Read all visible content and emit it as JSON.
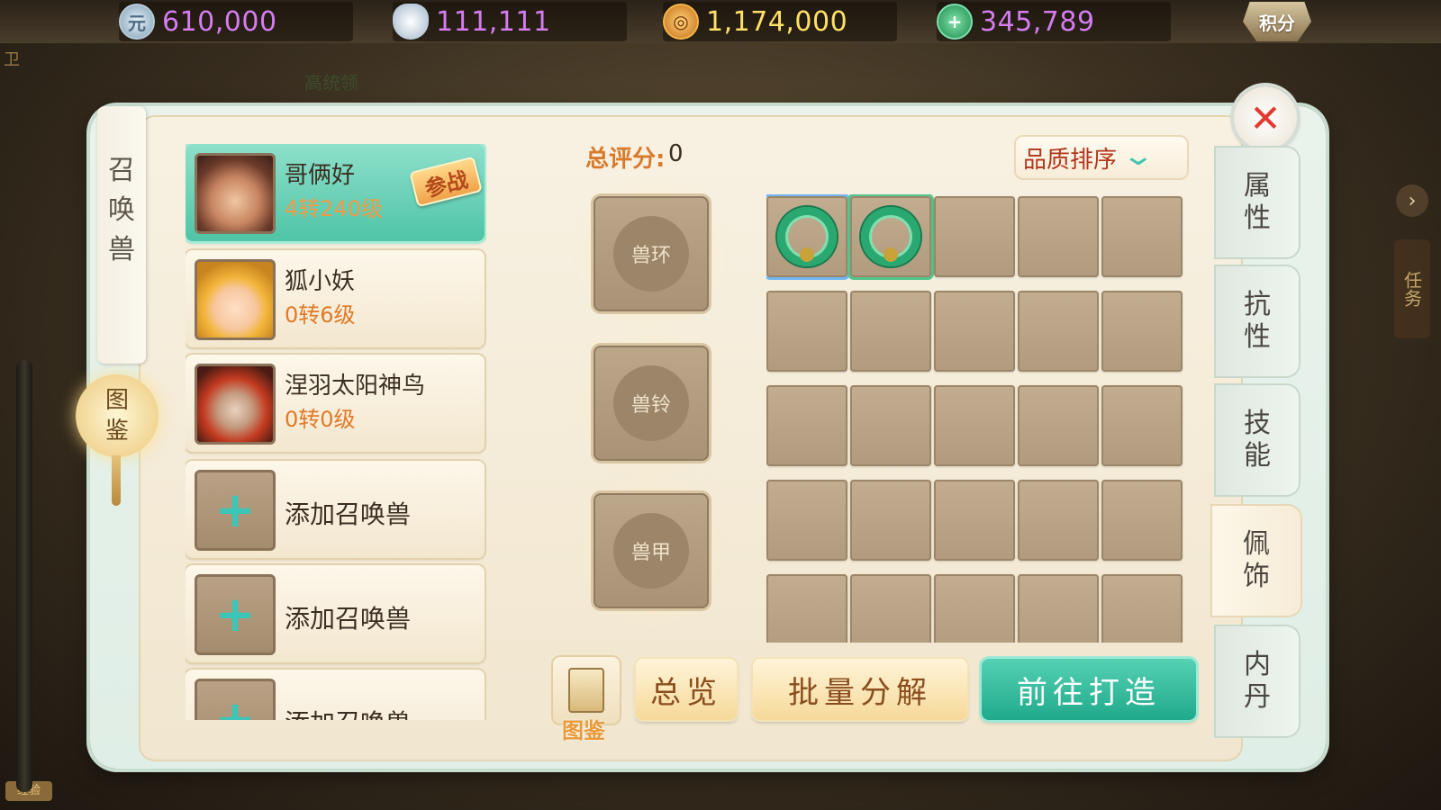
{
  "currencies": [
    {
      "icon": "yuanbao-icon",
      "glyph": "元",
      "value": "610,000",
      "color": "#d47cf0"
    },
    {
      "icon": "silver-ingot-icon",
      "glyph": "",
      "value": "111,111",
      "color": "#d47cf0"
    },
    {
      "icon": "copper-coin-icon",
      "glyph": "◎",
      "value": "1,174,000",
      "color": "#ffe066"
    },
    {
      "icon": "jade-plus-icon",
      "glyph": "+",
      "value": "345,789",
      "color": "#d47cf0"
    }
  ],
  "jifen_label": "积分",
  "background": {
    "npc_name": "高统领",
    "left_char": "卫",
    "corner_badge": "经验",
    "right_hint": "任务"
  },
  "side": {
    "scroll_title": [
      "召",
      "唤",
      "兽"
    ],
    "lantern": [
      "图",
      "鉴"
    ]
  },
  "pets": [
    {
      "name": "哥俩好",
      "level": "4转240级",
      "badge": "参战",
      "active": true
    },
    {
      "name": "狐小妖",
      "level": "0转6级"
    },
    {
      "name": "涅羽太阳神鸟",
      "level": "0转0级"
    }
  ],
  "add_pet_label": "添加召唤兽",
  "score": {
    "label": "总评分:",
    "value": "0"
  },
  "equip_slots": [
    "兽环",
    "兽铃",
    "兽甲"
  ],
  "sort_label": "品质排序",
  "grid": {
    "rows": 5,
    "cols": 5,
    "items": [
      {
        "index": 0,
        "icon": "laurel-wreath-icon",
        "state": "selected"
      },
      {
        "index": 1,
        "icon": "laurel-wreath-icon",
        "state": "owned"
      }
    ]
  },
  "tabs": [
    {
      "label": [
        "属",
        "性"
      ]
    },
    {
      "label": [
        "抗",
        "性"
      ]
    },
    {
      "label": [
        "技",
        "能"
      ]
    },
    {
      "label": [
        "佩",
        "饰"
      ],
      "active": true
    },
    {
      "label": [
        "内",
        "丹"
      ]
    }
  ],
  "buttons": {
    "atlas_label": "图鉴",
    "overview": "总览",
    "batch_decompose": "批量分解",
    "go_forge": "前往打造"
  }
}
